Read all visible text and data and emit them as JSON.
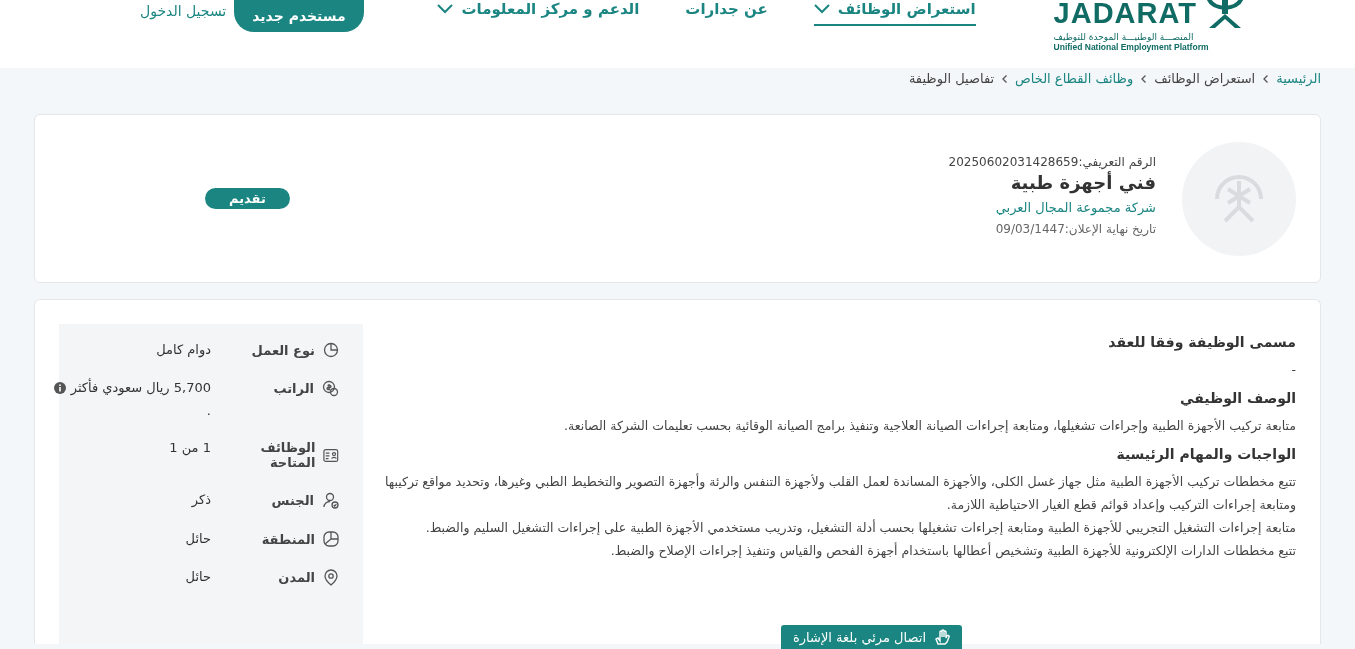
{
  "header": {
    "logo": {
      "name": "JADARAT",
      "tagline_ar": "المنصـــة الوطنيـــة الموحدة للتوظيف",
      "tagline_en": "Unified National Employment Platform"
    },
    "nav": [
      {
        "label": "استعراض الوظائف",
        "selected": true,
        "dropdown": true
      },
      {
        "label": "عن جدارات",
        "selected": false,
        "dropdown": false
      },
      {
        "label": "الدعم و مركز المعلومات",
        "selected": false,
        "dropdown": true
      }
    ],
    "register_button": "مستخدم جديد",
    "login_link": "تسجيل الدخول"
  },
  "breadcrumb": [
    {
      "label": "الرئيسية",
      "link": true
    },
    {
      "label": "استعراض الوظائف",
      "link": false
    },
    {
      "label": "وظائف القطاع الخاص",
      "link": true
    },
    {
      "label": "تفاصيل الوظيفة",
      "link": false
    }
  ],
  "job": {
    "id_text": "الرقم التعريفي:20250602031428659",
    "title": "فني أجهزة طبية",
    "company": "شركة مجموعة المجال العربي",
    "deadline": "تاريخ نهاية الإعلان:09/03/1447",
    "apply_button": "تقديم"
  },
  "details": {
    "sections": [
      {
        "heading": "مسمى الوظيفة وفقا للعقد",
        "paragraphs": [
          "-"
        ]
      },
      {
        "heading": "الوصف الوظيفي",
        "paragraphs": [
          "متابعة تركيب الأجهزة الطبية وإجراءات تشغيلها، ومتابعة إجراءات الصيانة العلاجية وتنفيذ برامج الصيانة الوقائية بحسب تعليمات الشركة الصانعة."
        ]
      },
      {
        "heading": "الواجبات والمهام الرئيسية",
        "paragraphs": [
          "تتبع مخططات تركيب الأجهزة الطبية مثل جهاز غسل الكلى، والأجهزة المساندة لعمل القلب ولأجهزة التنفس والرئة وأجهزة التصوير والتخطيط الطبي وغيرها، وتحديد مواقع تركيبها ومتابعة إجراءات التركيب وإعداد قوائم قطع الغيار الاحتياطية اللازمة.",
          "متابعة إجراءات التشغيل التجريبي للأجهزة الطبية ومتابعة إجراءات تشغيلها بحسب أدلة التشغيل، وتدريب مستخدمي الأجهزة الطبية على إجراءات التشغيل السليم والضبط.",
          "تتبع مخططات الدارات الإلكترونية للأجهزة الطبية وتشخيص أعطالها باستخدام أجهزة الفحص والقياس وتنفيذ إجراءات الإصلاح والضبط."
        ]
      }
    ],
    "facts": [
      {
        "kind": "clock",
        "label": "نوع العمل",
        "value": "دوام كامل"
      },
      {
        "kind": "money",
        "label": "الراتب",
        "value": "5,700 ريال سعودي فأكثر",
        "info": true,
        "note": "."
      },
      {
        "kind": "card",
        "label": "الوظائف المتاحة",
        "value": "1 من 1"
      },
      {
        "kind": "person",
        "label": "الجنس",
        "value": "ذكر"
      },
      {
        "kind": "map",
        "label": "المنطقة",
        "value": "حائل"
      },
      {
        "kind": "pin",
        "label": "المدن",
        "value": "حائل"
      }
    ]
  },
  "sign_language_button": "اتصال مرئي بلغة الإشارة"
}
